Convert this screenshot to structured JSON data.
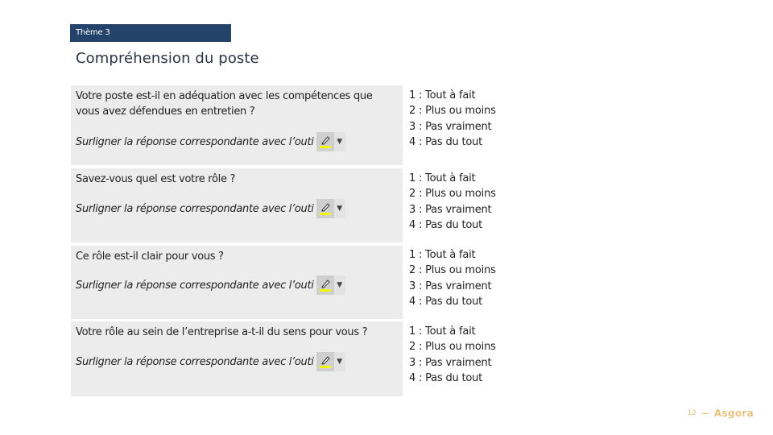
{
  "header": {
    "theme_label": "Thème 3",
    "title": "Compréhension du poste"
  },
  "questions": [
    {
      "question": "Votre poste est-il en adéquation avec les compétences que vous avez défendues en entretien ?",
      "instruction": "Surligner la réponse correspondante avec l’outi",
      "highlight_tool_icon": "highlighter-icon",
      "highlight_color": "#f5f50a",
      "answers": [
        "1 : Tout à fait",
        "2 : Plus ou moins",
        "3 : Pas vraiment",
        "4 : Pas du tout"
      ]
    },
    {
      "question": "Savez-vous quel est votre rôle ?",
      "instruction": "Surligner la réponse correspondante avec l’outi",
      "highlight_tool_icon": "highlighter-icon",
      "highlight_color": "#f5f50a",
      "answers": [
        "1 : Tout à fait",
        "2 : Plus ou moins",
        "3 : Pas vraiment",
        "4 : Pas du tout"
      ]
    },
    {
      "question": "Ce rôle est-il clair pour vous ?",
      "instruction": "Surligner la réponse correspondante avec l’outi",
      "highlight_tool_icon": "highlighter-icon",
      "highlight_color": "#f5f50a",
      "answers": [
        "1 : Tout à fait",
        "2 : Plus ou moins",
        "3 : Pas vraiment",
        "4 : Pas du tout"
      ]
    },
    {
      "question": "Votre rôle au sein de l’entreprise  a-t-il du sens pour vous ?",
      "instruction": "Surligner la réponse correspondante avec l’outi",
      "highlight_tool_icon": "highlighter-icon",
      "highlight_color": "#f5f50a",
      "answers": [
        "1 : Tout à fait",
        "2 : Plus ou moins",
        "3 : Pas vraiment",
        "4 : Pas du tout"
      ]
    }
  ],
  "footer": {
    "page_number": "12",
    "separator": "—",
    "brand": "Asgora",
    "brand_color": "#e8c480"
  },
  "colors": {
    "theme_bar": "#23436a",
    "cell_background": "#ececec"
  }
}
